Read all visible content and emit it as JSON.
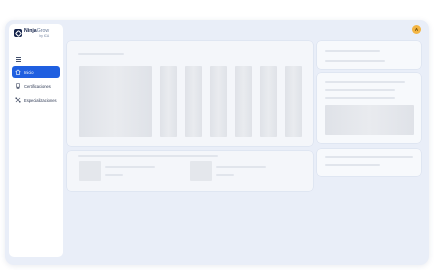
{
  "window": {
    "controls": [
      "close-dot",
      "minimize-dot",
      "maximize-dot"
    ]
  },
  "brand": {
    "name_bold": "Ninja",
    "name_light": "Grow",
    "subtitle": "by ICA"
  },
  "sidebar": {
    "menu_icon": "hamburger-icon",
    "items": [
      {
        "label": "Inicio",
        "icon": "home-icon",
        "active": true
      },
      {
        "label": "Certificaciones",
        "icon": "certificate-icon",
        "active": false
      },
      {
        "label": "Especializaciones",
        "icon": "specializations-icon",
        "active": false
      }
    ]
  },
  "user": {
    "avatar_initial": "A"
  },
  "colors": {
    "accent": "#1f5fe0",
    "background": "#e9eef8",
    "avatar": "#f3b544"
  }
}
